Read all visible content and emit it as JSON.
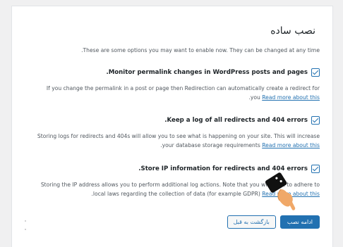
{
  "wizard": {
    "title": "نصب ساده",
    "intro": ".These are some options you may want to enable now. They can be changed at any time",
    "options": [
      {
        "heading": ".Monitor permalink changes in WordPress posts and pages",
        "checked": true,
        "desc_line1": "If you change the permalink in a post or page then Redirection can automatically create a redirect for",
        "desc_line2_text": ".you",
        "link": "Read more about this"
      },
      {
        "heading": ".Keep a log of all redirects and 404 errors",
        "checked": true,
        "desc_line1": "Storing logs for redirects and 404s will allow you to see what is happening on your site. This will increase",
        "desc_line2_text": ".your database storage requirements",
        "link": "Read more about this"
      },
      {
        "heading": ".Store IP information for redirects and 404 errors",
        "checked": true,
        "desc_line1": "Storing the IP address allows you to perform additional log actions. Note that you will need to adhere to",
        "desc_line2_text": ".local laws regarding the collection of data (for example GDPR)",
        "link": "Read more about this"
      }
    ],
    "buttons": {
      "continue": "ادامه نصب",
      "back": "بازگشت به قبل"
    }
  },
  "colors": {
    "accent": "#2271b1",
    "text": "#50575e",
    "heading": "#1d2327"
  },
  "icons": {
    "cursor": "pointing-hand-icon"
  }
}
